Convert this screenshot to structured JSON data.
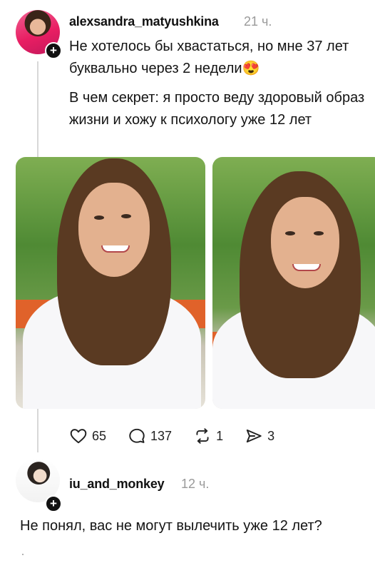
{
  "post": {
    "username": "alexsandra_matyushkina",
    "time": "21 ч.",
    "text_line_1": "Не хотелось бы хвастаться, но мне 37 лет буквально через 2 недели😍",
    "text_line_2": "В чем секрет: я просто веду здоровый образ жизни и хожу к психологу уже 12 лет",
    "actions": {
      "likes": "65",
      "comments": "137",
      "reposts": "1",
      "shares": "3"
    }
  },
  "reply": {
    "username": "iu_and_monkey",
    "time": "12 ч.",
    "text": "Не понял, вас не могут вылечить уже 12 лет?"
  },
  "icons": {
    "like": "heart-icon",
    "comment": "comment-bubble-icon",
    "repost": "repost-icon",
    "share": "send-icon",
    "follow": "plus-icon"
  },
  "colors": {
    "text": "#141414",
    "muted": "#9a9a9a",
    "thread_line": "#d8d8d8"
  }
}
